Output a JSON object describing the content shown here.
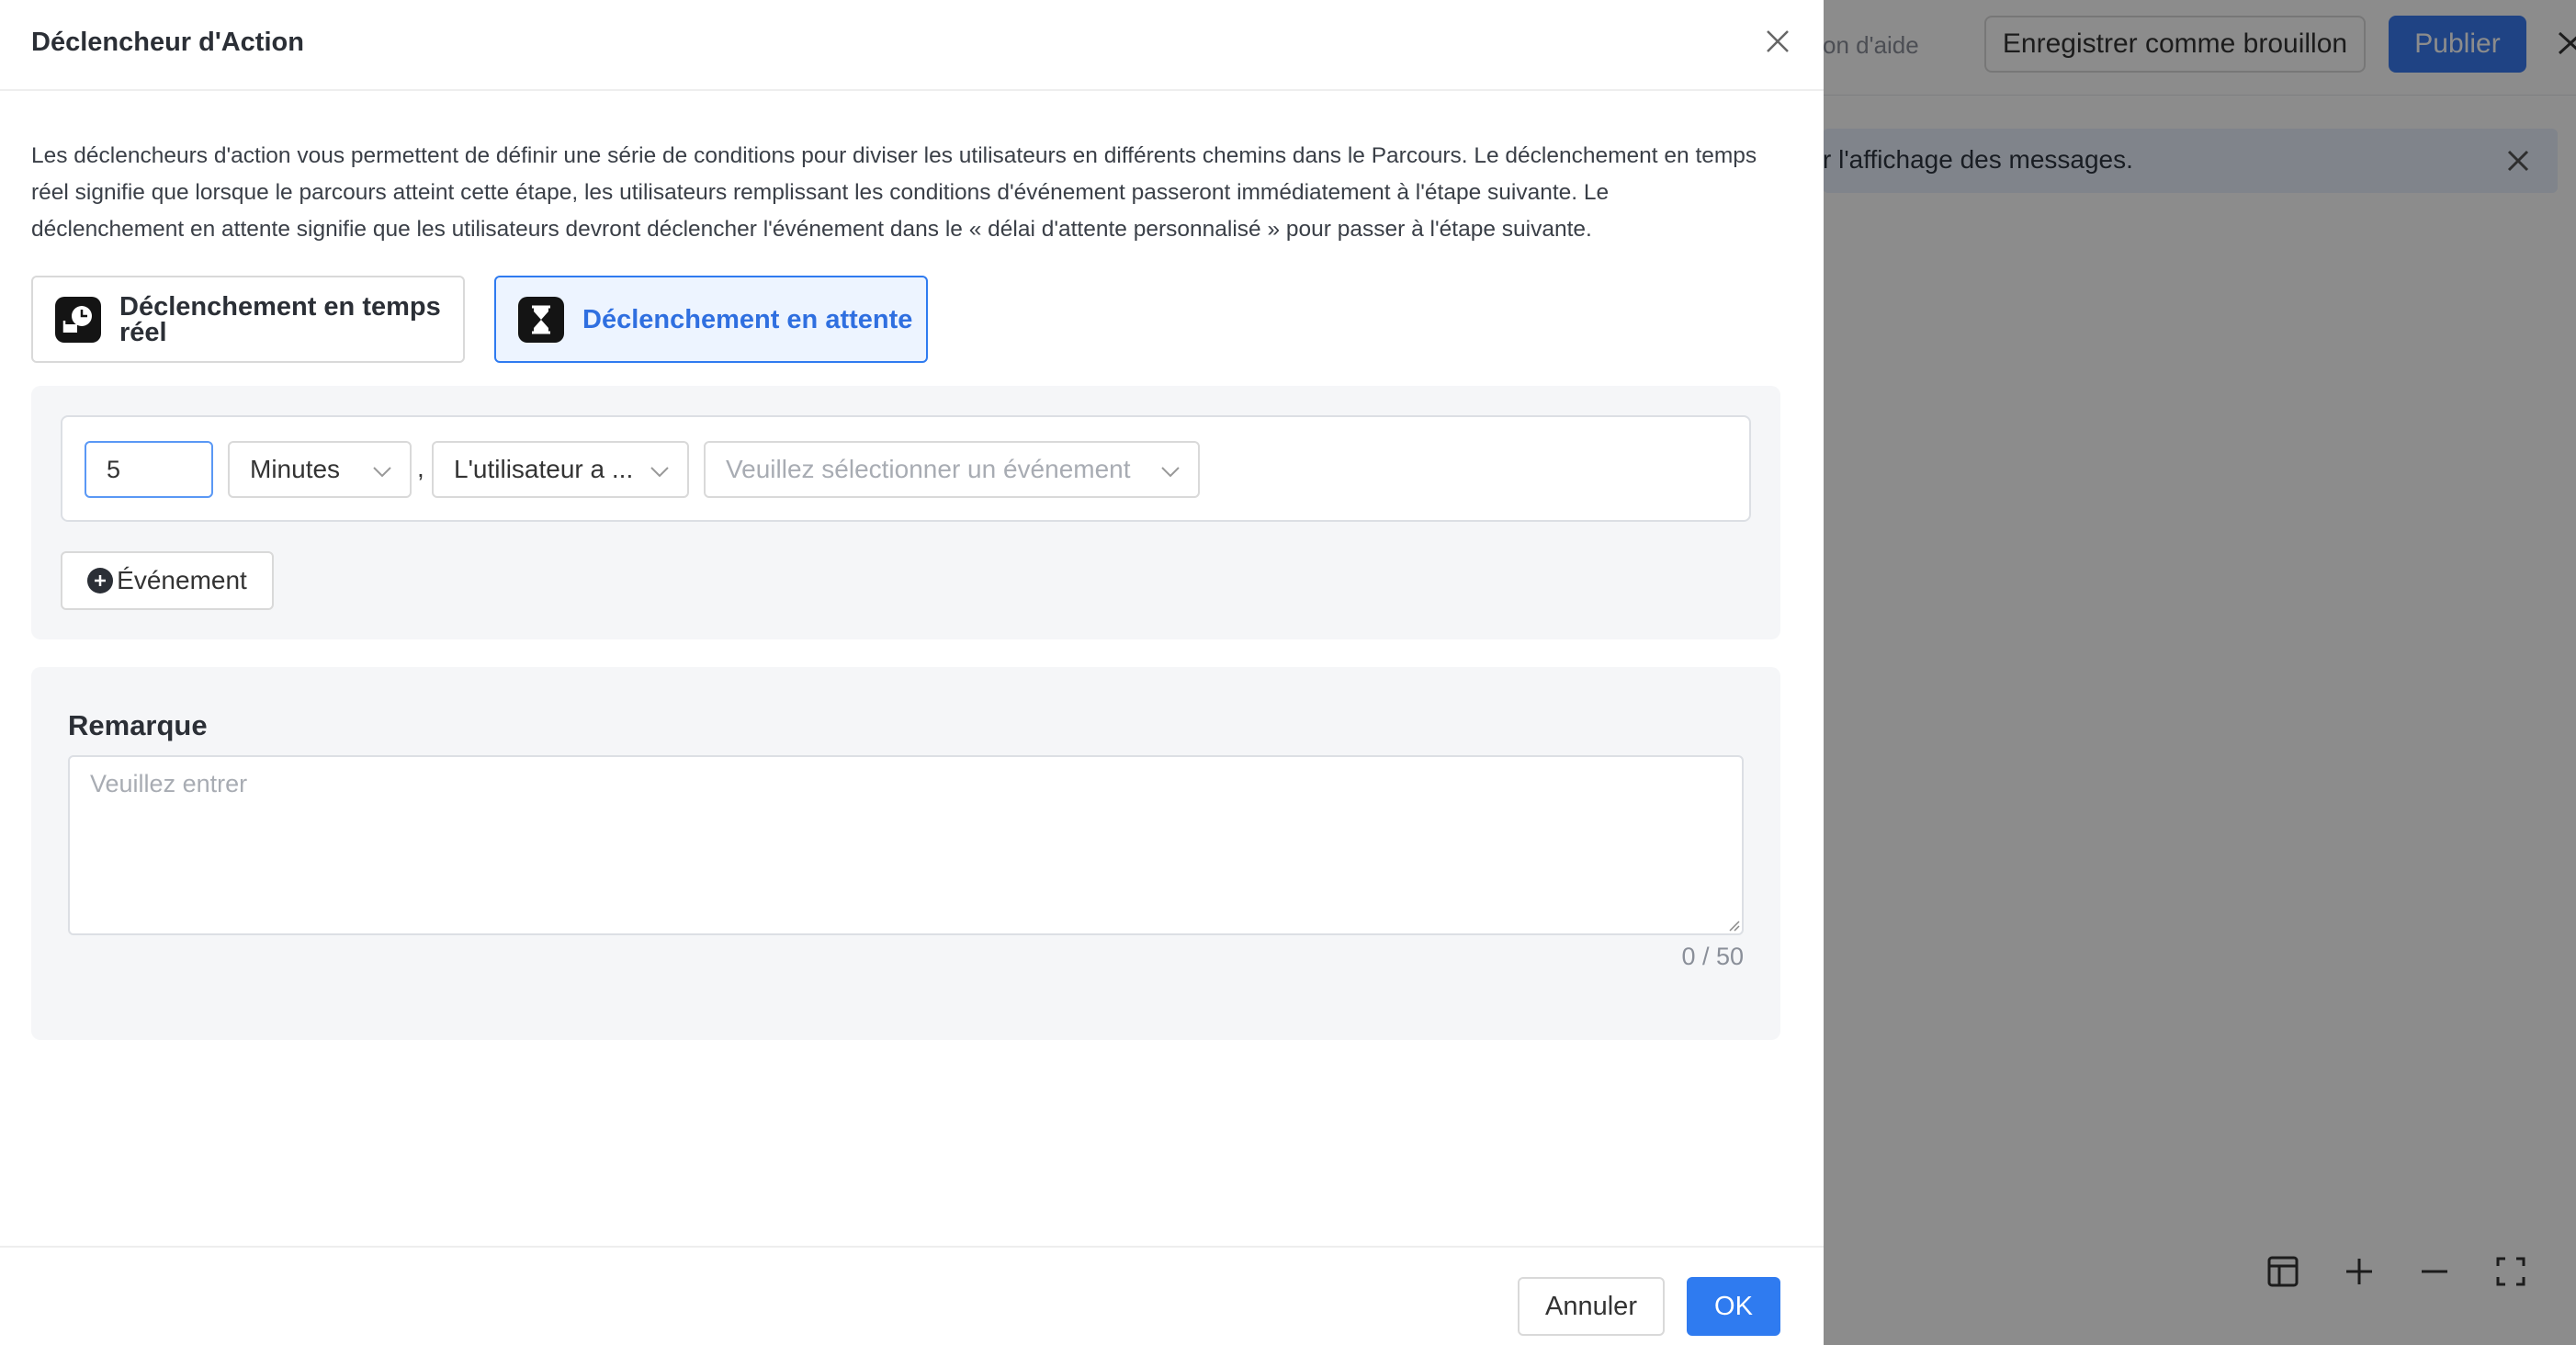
{
  "background": {
    "help_text": "on d'aide",
    "save_draft_label": "Enregistrer comme brouillon",
    "publish_label": "Publier",
    "banner_text": "r l'affichage des messages."
  },
  "drawer": {
    "title": "Déclencheur d'Action",
    "description": "Les déclencheurs d'action vous permettent de définir une série de conditions pour diviser les utilisateurs en différents chemins dans le Parcours. Le déclenchement en temps réel signifie que lorsque le parcours atteint cette étape, les utilisateurs remplissant les conditions d'événement passeront immédiatement à l'étape suivante. Le déclenchement en attente signifie que les utilisateurs devront déclencher l'événement dans le « délai d'attente personnalisé » pour passer à l'étape suivante.",
    "modes": [
      {
        "label": "Déclenchement en temps réel",
        "icon": "realtime-clock-icon",
        "selected": false
      },
      {
        "label": "Déclenchement en attente",
        "icon": "hourglass-icon",
        "selected": true
      }
    ],
    "condition": {
      "duration_value": "5",
      "unit": "Minutes",
      "separator": ",",
      "user_action": "L'utilisateur a ...",
      "event_placeholder": "Veuillez sélectionner un événement"
    },
    "add_event_label": "Événement",
    "remark": {
      "title": "Remarque",
      "placeholder": "Veuillez entrer",
      "counter": "0 / 50"
    },
    "footer": {
      "cancel_label": "Annuler",
      "ok_label": "OK"
    }
  },
  "colors": {
    "primary": "#2f7bf0",
    "selected_bg": "#edf4ff",
    "panel_bg": "#f5f6f8",
    "overlay": "rgba(0,0,0,0.45)"
  }
}
